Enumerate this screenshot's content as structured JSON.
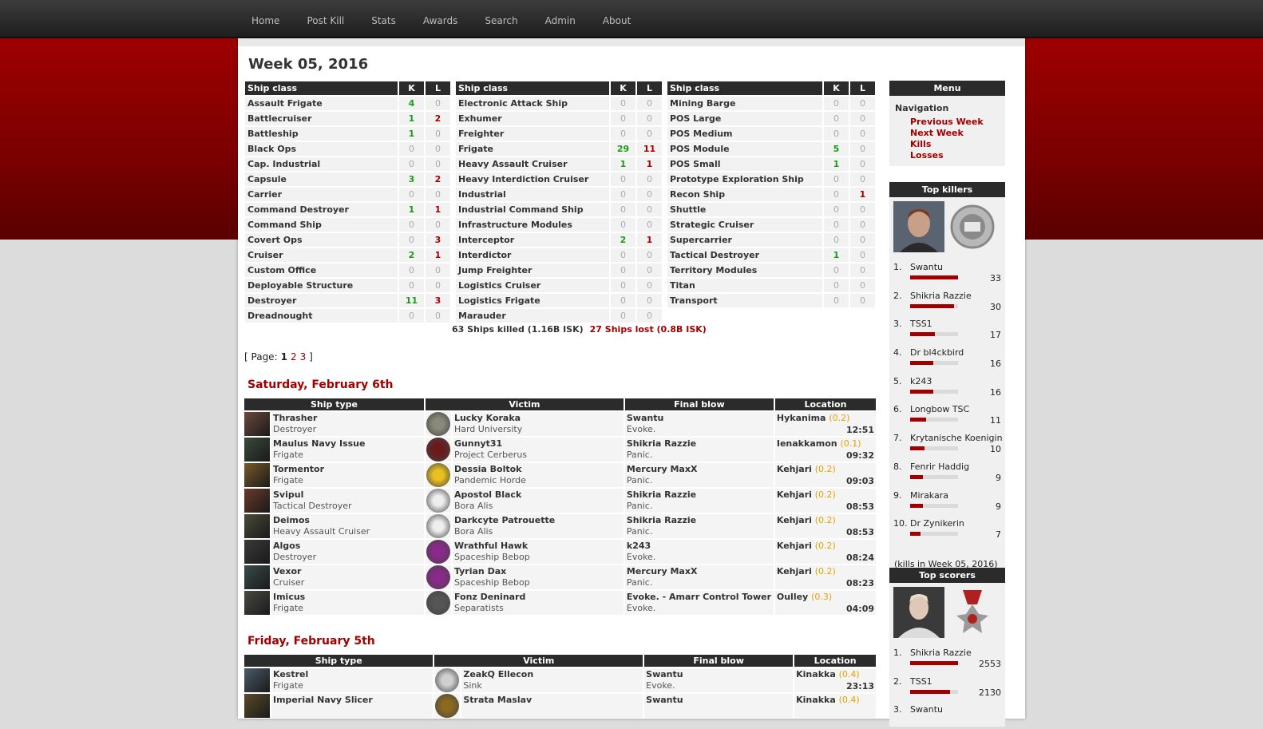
{
  "nav": [
    "Home",
    "Post Kill",
    "Stats",
    "Awards",
    "Search",
    "Admin",
    "About"
  ],
  "week_title": "Week 05, 2016",
  "class_headers": {
    "ship_class": "Ship class",
    "k": "K",
    "l": "L"
  },
  "class_tables": [
    [
      [
        "Assault Frigate",
        4,
        0
      ],
      [
        "Battlecruiser",
        1,
        2
      ],
      [
        "Battleship",
        1,
        0
      ],
      [
        "Black Ops",
        0,
        0
      ],
      [
        "Cap. Industrial",
        0,
        0
      ],
      [
        "Capsule",
        3,
        2
      ],
      [
        "Carrier",
        0,
        0
      ],
      [
        "Command Destroyer",
        1,
        1
      ],
      [
        "Command Ship",
        0,
        0
      ],
      [
        "Covert Ops",
        0,
        3
      ],
      [
        "Cruiser",
        2,
        1
      ],
      [
        "Custom Office",
        0,
        0
      ],
      [
        "Deployable Structure",
        0,
        0
      ],
      [
        "Destroyer",
        11,
        3
      ],
      [
        "Dreadnought",
        0,
        0
      ]
    ],
    [
      [
        "Electronic Attack Ship",
        0,
        0
      ],
      [
        "Exhumer",
        0,
        0
      ],
      [
        "Freighter",
        0,
        0
      ],
      [
        "Frigate",
        29,
        11
      ],
      [
        "Heavy Assault Cruiser",
        1,
        1
      ],
      [
        "Heavy Interdiction Cruiser",
        0,
        0
      ],
      [
        "Industrial",
        0,
        0
      ],
      [
        "Industrial Command Ship",
        0,
        0
      ],
      [
        "Infrastructure Modules",
        0,
        0
      ],
      [
        "Interceptor",
        2,
        1
      ],
      [
        "Interdictor",
        0,
        0
      ],
      [
        "Jump Freighter",
        0,
        0
      ],
      [
        "Logistics Cruiser",
        0,
        0
      ],
      [
        "Logistics Frigate",
        0,
        0
      ],
      [
        "Marauder",
        0,
        0
      ]
    ],
    [
      [
        "Mining Barge",
        0,
        0
      ],
      [
        "POS Large",
        0,
        0
      ],
      [
        "POS Medium",
        0,
        0
      ],
      [
        "POS Module",
        5,
        0
      ],
      [
        "POS Small",
        1,
        0
      ],
      [
        "Prototype Exploration Ship",
        0,
        0
      ],
      [
        "Recon Ship",
        0,
        1
      ],
      [
        "Shuttle",
        0,
        0
      ],
      [
        "Strategic Cruiser",
        0,
        0
      ],
      [
        "Supercarrier",
        0,
        0
      ],
      [
        "Tactical Destroyer",
        1,
        0
      ],
      [
        "Territory Modules",
        0,
        0
      ],
      [
        "Titan",
        0,
        0
      ],
      [
        "Transport",
        0,
        0
      ]
    ]
  ],
  "summary": {
    "killed": "63 Ships killed (1.16B ISK)",
    "lost": "27 Ships lost (0.8B ISK)"
  },
  "pager": {
    "label": "Page:",
    "current": "1",
    "pages": [
      "2",
      "3"
    ],
    "open": "[",
    "close": "]"
  },
  "kill_headers": {
    "ship": "Ship type",
    "victim": "Victim",
    "final": "Final blow",
    "location": "Location"
  },
  "days": [
    {
      "title": "Saturday, February 6th",
      "kills": [
        {
          "ship": "Thrasher",
          "type": "Destroyer",
          "victim": "Lucky Koraka",
          "corp": "Hard University",
          "final": "Swantu",
          "fcorp": "Evoke.",
          "sys": "Hykanima",
          "sec": "(0.2)",
          "time": "12:51",
          "color": "#6a4a3a",
          "vcolor": "#8a8a7a"
        },
        {
          "ship": "Maulus Navy Issue",
          "type": "Frigate",
          "victim": "Gunnyt31",
          "corp": "Project Cerberus",
          "final": "Shikria Razzie",
          "fcorp": "Panic.",
          "sys": "Ienakkamon",
          "sec": "(0.1)",
          "time": "09:32",
          "color": "#3a4a3a",
          "vcolor": "#6a1a1a"
        },
        {
          "ship": "Tormentor",
          "type": "Frigate",
          "victim": "Dessia Boltok",
          "corp": "Pandemic Horde",
          "final": "Mercury MaxX",
          "fcorp": "Panic.",
          "sys": "Kehjari",
          "sec": "(0.2)",
          "time": "09:03",
          "color": "#7a5a2a",
          "vcolor": "#e8c020"
        },
        {
          "ship": "Svipul",
          "type": "Tactical Destroyer",
          "victim": "Apostol Black",
          "corp": "Bora Alis",
          "final": "Shikria Razzie",
          "fcorp": "Panic.",
          "sys": "Kehjari",
          "sec": "(0.2)",
          "time": "08:53",
          "color": "#6a3a2a",
          "vcolor": "#eeeeee"
        },
        {
          "ship": "Deimos",
          "type": "Heavy Assault Cruiser",
          "victim": "Darkcyte Patrouette",
          "corp": "Bora Alis",
          "final": "Shikria Razzie",
          "fcorp": "Panic.",
          "sys": "Kehjari",
          "sec": "(0.2)",
          "time": "08:53",
          "color": "#4a4a3a",
          "vcolor": "#eeeeee"
        },
        {
          "ship": "Algos",
          "type": "Destroyer",
          "victim": "Wrathful Hawk",
          "corp": "Spaceship Bebop",
          "final": "k243",
          "fcorp": "Evoke.",
          "sys": "Kehjari",
          "sec": "(0.2)",
          "time": "08:24",
          "color": "#3a3a3a",
          "vcolor": "#8a2a8a"
        },
        {
          "ship": "Vexor",
          "type": "Cruiser",
          "victim": "Tyrian Dax",
          "corp": "Spaceship Bebop",
          "final": "Mercury MaxX",
          "fcorp": "Panic.",
          "sys": "Kehjari",
          "sec": "(0.2)",
          "time": "08:23",
          "color": "#3a4a4a",
          "vcolor": "#8a2a8a"
        },
        {
          "ship": "Imicus",
          "type": "Frigate",
          "victim": "Fonz Deninard",
          "corp": "Separatists",
          "final": "Evoke. - Amarr Control Tower",
          "fcorp": "Evoke.",
          "sys": "Oulley",
          "sec": "(0.3)",
          "time": "04:09",
          "color": "#4a4a42",
          "vcolor": "#555555"
        }
      ]
    },
    {
      "title": "Friday, February 5th",
      "kills": [
        {
          "ship": "Kestrel",
          "type": "Frigate",
          "victim": "ZeakQ Ellecon",
          "corp": "Sink",
          "final": "Swantu",
          "fcorp": "Evoke.",
          "sys": "Kinakka",
          "sec": "(0.4)",
          "time": "23:13",
          "color": "#4a5a6a",
          "vcolor": "#d0d0d0"
        },
        {
          "ship": "Imperial Navy Slicer",
          "type": "",
          "victim": "Strata Maslav",
          "corp": "",
          "final": "Swantu",
          "fcorp": "",
          "sys": "Kinakka",
          "sec": "(0.4)",
          "time": "",
          "color": "#5a4a2a",
          "vcolor": "#8a6a20"
        }
      ]
    }
  ],
  "menu": {
    "title": "Menu",
    "nav_label": "Navigation",
    "links": [
      "Previous Week",
      "Next Week",
      "Kills",
      "Losses"
    ]
  },
  "top_killers": {
    "title": "Top killers",
    "list": [
      [
        "1.",
        "Swantu",
        33
      ],
      [
        "2.",
        "Shikria Razzie",
        30
      ],
      [
        "3.",
        "TSS1",
        17
      ],
      [
        "4.",
        "Dr bl4ckbird",
        16
      ],
      [
        "5.",
        "k243",
        16
      ],
      [
        "6.",
        "Longbow TSC",
        11
      ],
      [
        "7.",
        "Krytanische Koenigin",
        10
      ],
      [
        "8.",
        "Fenrir Haddig",
        9
      ],
      [
        "9.",
        "Mirakara",
        9
      ],
      [
        "10.",
        "Dr Zynikerin",
        7
      ]
    ],
    "max": 33,
    "footer": "(kills in Week 05, 2016)"
  },
  "top_scorers": {
    "title": "Top scorers",
    "list": [
      [
        "1.",
        "Shikria Razzie",
        2553
      ],
      [
        "2.",
        "TSS1",
        2130
      ],
      [
        "3.",
        "Swantu",
        null
      ]
    ],
    "max": 2553
  }
}
